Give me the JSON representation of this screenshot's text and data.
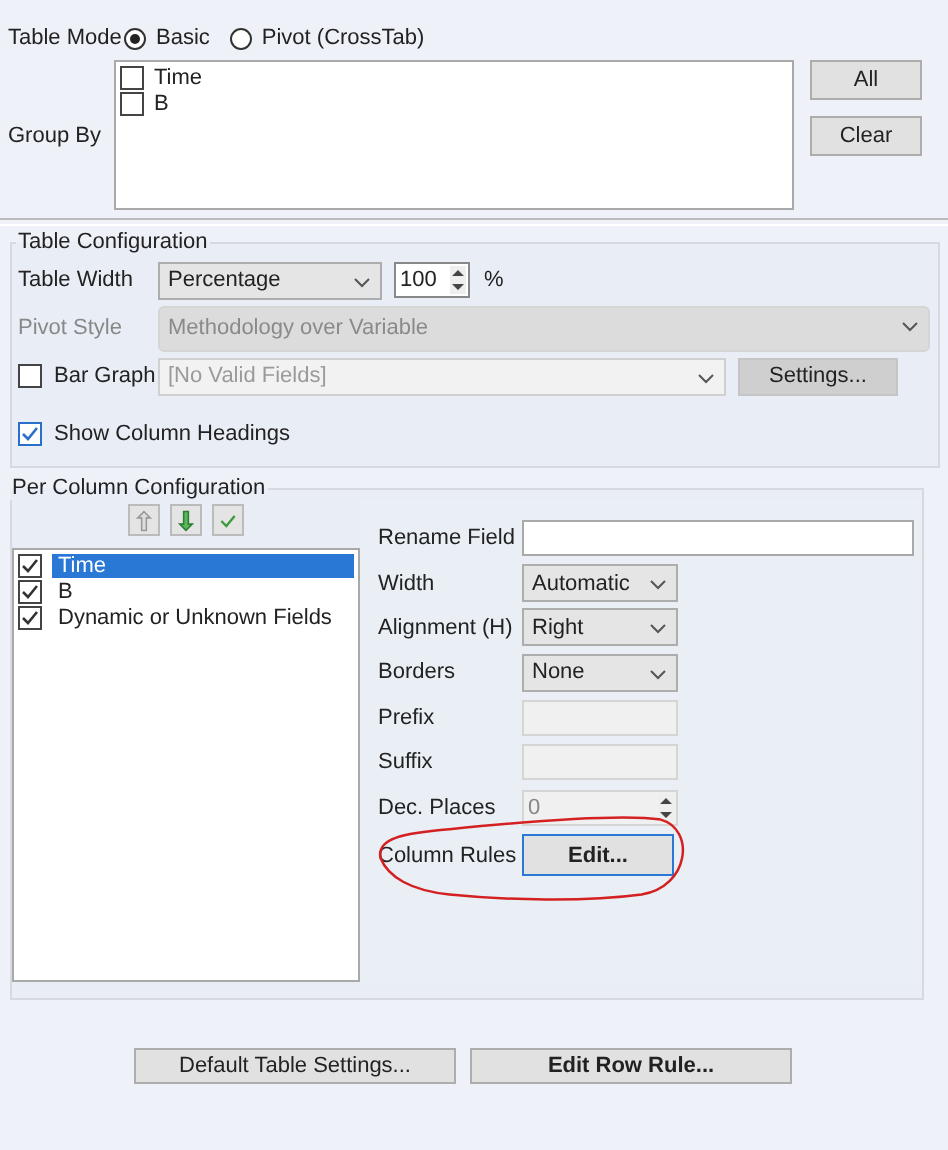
{
  "table_mode": {
    "label": "Table Mode",
    "options": [
      {
        "label": "Basic",
        "selected": true
      },
      {
        "label": "Pivot (CrossTab)",
        "selected": false
      }
    ]
  },
  "group_by": {
    "label": "Group By",
    "items": [
      {
        "label": "Time",
        "checked": false
      },
      {
        "label": "B",
        "checked": false
      }
    ],
    "buttons": [
      "All",
      "Clear"
    ]
  },
  "table_configuration": {
    "title": "Table Configuration",
    "table_width": {
      "label": "Table Width",
      "mode": "Percentage",
      "value": "100",
      "unit": "%"
    },
    "pivot_style": {
      "label": "Pivot Style",
      "value": "Methodology over Variable",
      "disabled": true
    },
    "bar_graph": {
      "label": "Bar Graph",
      "checked": false,
      "value": "[No Valid Fields]",
      "button": "Settings...",
      "disabled": true
    },
    "show_column_headings": {
      "label": "Show Column Headings",
      "checked": true
    }
  },
  "per_column": {
    "title": "Per Column Configuration",
    "fields": [
      {
        "label": "Time",
        "checked": true,
        "selected": true
      },
      {
        "label": "B",
        "checked": true,
        "selected": false
      },
      {
        "label": "Dynamic or Unknown Fields",
        "checked": true,
        "selected": false
      }
    ],
    "properties": [
      {
        "kind": "text",
        "label": "Rename Field",
        "disabled": false
      },
      {
        "kind": "select",
        "label": "Width",
        "value": "Automatic",
        "disabled": false
      },
      {
        "kind": "select",
        "label": "Alignment (H)",
        "value": "Right",
        "disabled": false
      },
      {
        "kind": "select",
        "label": "Borders",
        "value": "None",
        "disabled": false
      },
      {
        "kind": "text",
        "label": "Prefix",
        "disabled": true
      },
      {
        "kind": "text",
        "label": "Suffix",
        "disabled": true
      },
      {
        "kind": "spinner",
        "label": "Dec. Places",
        "value": "0",
        "disabled": true
      },
      {
        "kind": "button",
        "label": "Column Rules",
        "value": "Edit...",
        "disabled": false
      }
    ]
  },
  "buttons": [
    {
      "label": "Default Table Settings...",
      "bold": false
    },
    {
      "label": "Edit Row Rule...",
      "bold": true
    }
  ]
}
